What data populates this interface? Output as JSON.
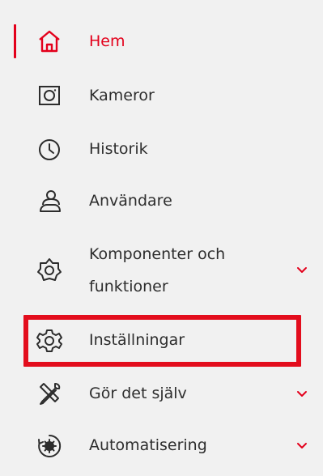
{
  "nav": {
    "items": [
      {
        "label": "Hem",
        "icon": "home-icon",
        "active": true
      },
      {
        "label": "Kameror",
        "icon": "camera-icon"
      },
      {
        "label": "Historik",
        "icon": "clock-icon"
      },
      {
        "label": "Användare",
        "icon": "users-icon"
      },
      {
        "label": "Komponenter och funktioner",
        "icon": "component-icon",
        "expandable": true
      },
      {
        "label": "Inställningar",
        "icon": "gear-icon",
        "highlighted": true
      },
      {
        "label": "Gör det själv",
        "icon": "tools-icon",
        "expandable": true
      },
      {
        "label": "Automatisering",
        "icon": "automation-icon",
        "expandable": true
      }
    ]
  },
  "colors": {
    "accent": "#e3001b",
    "text": "#2d2d2d",
    "background": "#f1f1f1"
  }
}
